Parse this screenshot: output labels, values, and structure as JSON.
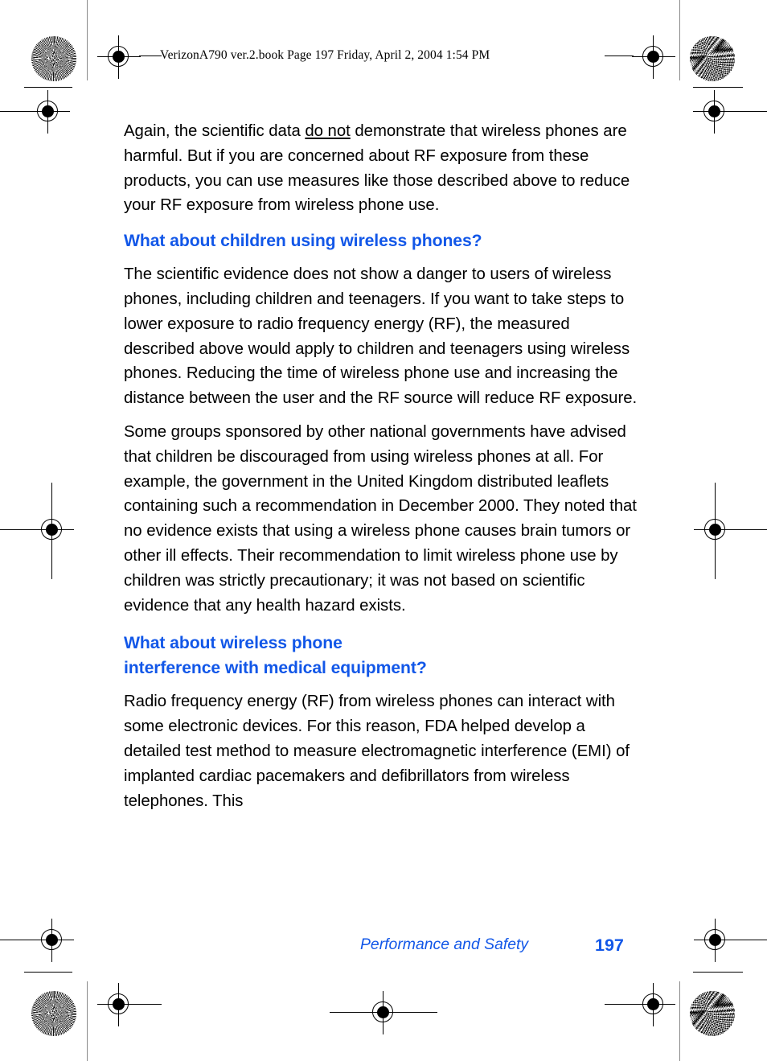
{
  "page": {
    "header_line": "VerizonA790 ver.2.book  Page 197  Friday, April 2, 2004  1:54 PM",
    "accent_color": "#1257E8",
    "text_color": "#000000",
    "background_color": "#FFFFFF"
  },
  "content": {
    "paragraph_1_before_underline": "Again, the scientific data ",
    "paragraph_1_underlined": "do not",
    "paragraph_1_after_underline": " demonstrate that wireless phones are harmful. But if you are concerned about RF exposure from these products, you can use measures like those described above to reduce your RF exposure from wireless phone use.",
    "heading_1": "What about children using wireless phones?",
    "paragraph_2": "The scientific evidence does not show a danger to users of wireless phones, including children and teenagers. If you want to take steps to lower exposure to radio frequency energy (RF), the measured described above would apply to children and teenagers using wireless phones. Reducing the time of wireless phone use and increasing the distance between the user and the RF source will reduce RF exposure.",
    "paragraph_3": "Some groups sponsored by other national governments have advised that children be discouraged from using wireless phones at all. For example, the government in the United Kingdom distributed leaflets containing such a recommendation in December 2000. They noted that no evidence exists that using a wireless phone causes brain tumors or other ill effects. Their recommendation to limit wireless phone use by children was strictly precautionary; it was not based on scientific evidence that any health hazard exists.",
    "heading_2_line_1": "What about wireless phone",
    "heading_2_line_2": "interference with medical equipment?",
    "paragraph_4": "Radio frequency energy (RF) from wireless phones can interact with some electronic devices. For this reason, FDA helped develop a detailed test method to measure electromagnetic interference (EMI) of implanted cardiac pacemakers and defibrillators from wireless telephones. This"
  },
  "footer": {
    "section_title": "Performance and Safety",
    "page_number": "197"
  }
}
